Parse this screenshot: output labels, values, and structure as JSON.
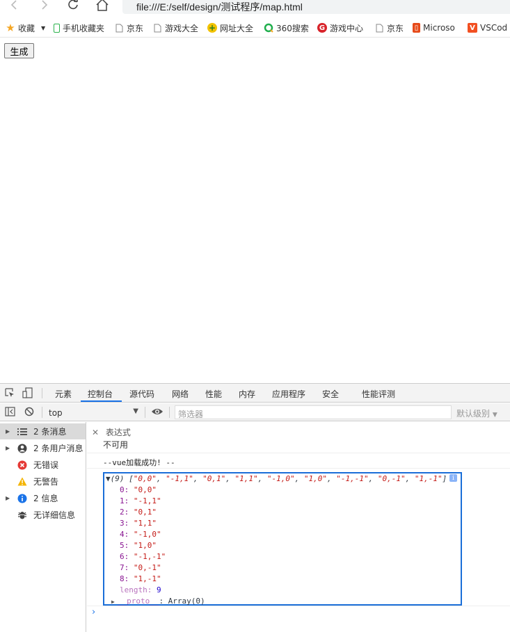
{
  "browser": {
    "url": "file:///E:/self/design/测试程序/map.html",
    "bookmarks": [
      {
        "label": "收藏",
        "icon": "star-icon"
      },
      {
        "label": "手机收藏夹",
        "icon": "phone-icon"
      },
      {
        "label": "京东",
        "icon": "page-icon"
      },
      {
        "label": "游戏大全",
        "icon": "page-icon"
      },
      {
        "label": "网址大全",
        "icon": "site-nav-icon"
      },
      {
        "label": "360搜索",
        "icon": "search-360-icon"
      },
      {
        "label": "游戏中心",
        "icon": "game-center-icon"
      },
      {
        "label": "京东",
        "icon": "page-icon"
      },
      {
        "label": "Microso",
        "icon": "office-icon"
      },
      {
        "label": "VSCod",
        "icon": "vscode-icon"
      }
    ]
  },
  "page": {
    "generate_button": "生成"
  },
  "devtools": {
    "tabs": [
      "元素",
      "控制台",
      "源代码",
      "网络",
      "性能",
      "内存",
      "应用程序",
      "安全",
      "性能评测"
    ],
    "active_tab": "控制台",
    "context": "top",
    "filter_placeholder": "筛选器",
    "levels_label": "默认级别",
    "sidebar": [
      {
        "label": "2 条消息",
        "icon": "list-icon",
        "expandable": true,
        "selected": true
      },
      {
        "label": "2 条用户消息",
        "icon": "user-icon",
        "expandable": true,
        "selected": false
      },
      {
        "label": "无错误",
        "icon": "error-icon",
        "expandable": false,
        "selected": false
      },
      {
        "label": "无警告",
        "icon": "warning-icon",
        "expandable": false,
        "selected": false
      },
      {
        "label": "2 信息",
        "icon": "info-icon",
        "expandable": true,
        "selected": false
      },
      {
        "label": "无详细信息",
        "icon": "verbose-icon",
        "expandable": false,
        "selected": false
      }
    ],
    "expression": {
      "title": "表达式",
      "value": "不可用"
    },
    "log_message": "--vue加载成功! --",
    "array": {
      "summary": "▼(9) [\"0,0\", \"-1,1\", \"0,1\", \"1,1\", \"-1,0\", \"1,0\", \"-1,-1\", \"0,-1\", \"1,-1\"]",
      "items": [
        {
          "index": "0:",
          "value": "\"0,0\""
        },
        {
          "index": "1:",
          "value": "\"-1,1\""
        },
        {
          "index": "2:",
          "value": "\"0,1\""
        },
        {
          "index": "3:",
          "value": "\"1,1\""
        },
        {
          "index": "4:",
          "value": "\"-1,0\""
        },
        {
          "index": "5:",
          "value": "\"1,0\""
        },
        {
          "index": "6:",
          "value": "\"-1,-1\""
        },
        {
          "index": "7:",
          "value": "\"0,-1\""
        },
        {
          "index": "8:",
          "value": "\"1,-1\""
        }
      ],
      "length_key": "length:",
      "length_value": "9",
      "proto_key": "__proto__",
      "proto_value": ": Array(0)"
    },
    "colors": {
      "accent": "#1a73e8",
      "string": "#c41a16",
      "key": "#881391",
      "number": "#1c00cf",
      "error": "#e53935",
      "warning": "#f4b400"
    }
  }
}
